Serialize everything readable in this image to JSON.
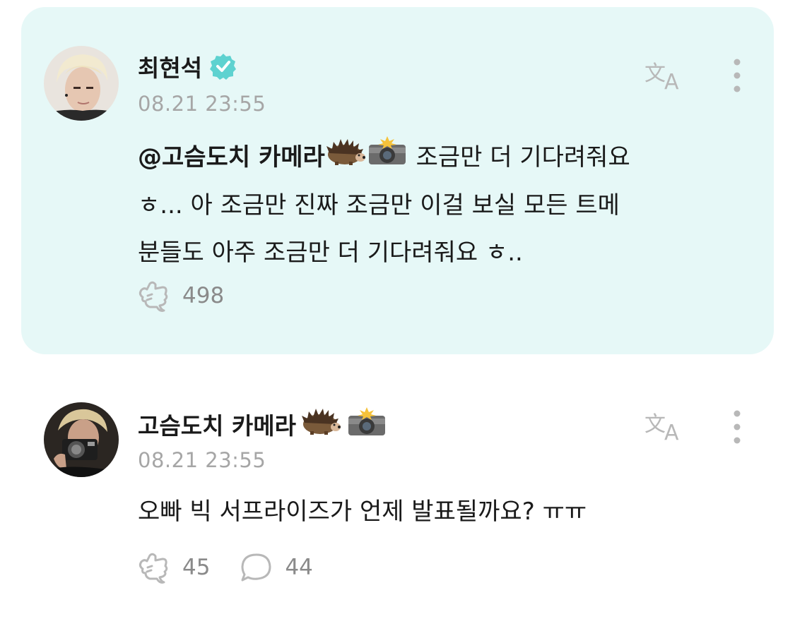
{
  "posts": [
    {
      "author": "최현석",
      "verified": true,
      "time": "08.21 23:55",
      "mention": "@고슴도치 카메라",
      "body_line1_rest": "조금만 더 기다려줘요",
      "body_line2": "ㅎ... 아 조금만 진짜 조금만 이걸 보실 모든 트메",
      "body_line3": "분들도 아주 조금만 더 기다려줘요 ㅎ..",
      "like_count": "498",
      "highlighted": true
    },
    {
      "author": "고슴도치 카메라",
      "verified": false,
      "time": "08.21 23:55",
      "body": "오빠 빅 서프라이즈가 언제 발표될까요? ㅠㅠ",
      "like_count": "45",
      "comment_count": "44"
    }
  ],
  "icons": {
    "translate": "translate-icon",
    "more": "more-icon",
    "like": "like-icon",
    "comment": "comment-icon",
    "verified": "verified-badge-icon",
    "hedgehog": "hedgehog-emoji",
    "camera_flash": "camera-flash-emoji"
  },
  "colors": {
    "highlight_bg": "#e6f8f7",
    "verified": "#5ed2d0",
    "muted": "#a6a6a6",
    "icon": "#b8b8b8"
  }
}
